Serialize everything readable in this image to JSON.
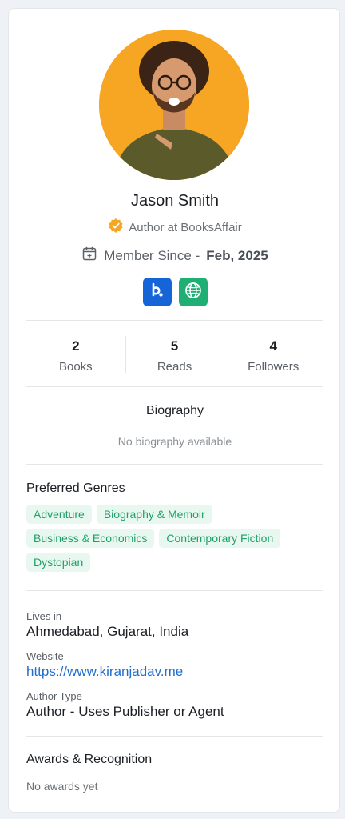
{
  "profile": {
    "name": "Jason Smith",
    "role": "Author at BooksAffair",
    "member_since_label": "Member Since -",
    "member_since_date": "Feb, 2025"
  },
  "socials": [
    {
      "icon": "booksaffair-logo-icon",
      "color": "#1565d8"
    },
    {
      "icon": "globe-icon",
      "color": "#1fae73"
    }
  ],
  "stats": [
    {
      "value": "2",
      "label": "Books"
    },
    {
      "value": "5",
      "label": "Reads"
    },
    {
      "value": "4",
      "label": "Followers"
    }
  ],
  "biography": {
    "title": "Biography",
    "text": "No biography available"
  },
  "genres": {
    "title": "Preferred Genres",
    "items": [
      "Adventure",
      "Biography & Memoir",
      "Business & Economics",
      "Contemporary Fiction",
      "Dystopian"
    ]
  },
  "info": {
    "lives_in_label": "Lives in",
    "lives_in_value": "Ahmedabad, Gujarat, India",
    "website_label": "Website",
    "website_value": "https://www.kiranjadav.me",
    "author_type_label": "Author Type",
    "author_type_value": "Author - Uses Publisher or Agent"
  },
  "awards": {
    "title": "Awards & Recognition",
    "text": "No awards yet"
  },
  "colors": {
    "accent_green": "#1ea069",
    "tag_background": "#e8f7ef",
    "link_blue": "#1f6fd1",
    "verified_badge": "#f5a623",
    "avatar_background": "#f6a623"
  }
}
